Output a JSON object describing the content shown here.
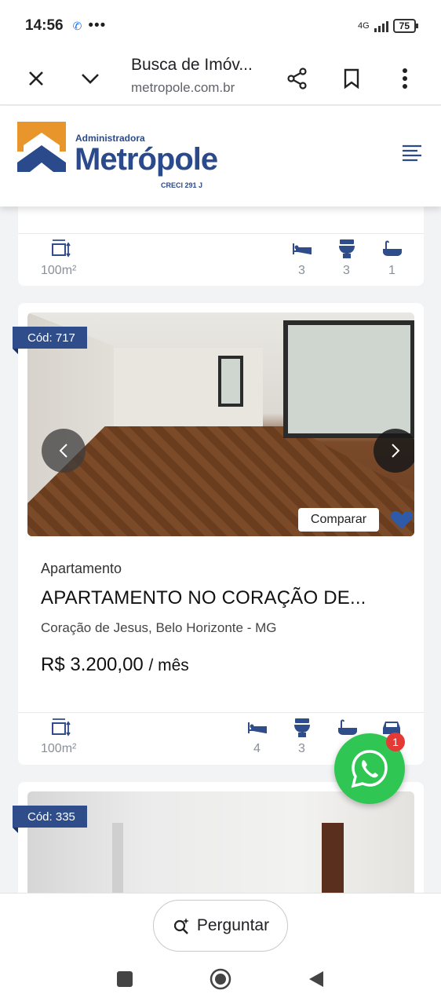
{
  "status": {
    "time": "14:56",
    "network": "4G",
    "battery": "75"
  },
  "browser": {
    "title": "Busca de Imóv...",
    "url": "metropole.com.br"
  },
  "site": {
    "brand_small": "Administradora",
    "brand": "Metrópole",
    "creci": "CRECI 291 J"
  },
  "card_top": {
    "area": "100m²",
    "bedrooms": "3",
    "bathrooms": "3",
    "suites": "1"
  },
  "listing": {
    "code": "Cód: 717",
    "compare_label": "Comparar",
    "type": "Apartamento",
    "title": "APARTAMENTO NO CORAÇÃO DE...",
    "location": "Coração de Jesus, Belo Horizonte - MG",
    "price": "R$ 3.200,00",
    "price_period": "/ mês",
    "area": "100m²",
    "bedrooms": "4",
    "bathrooms": "3"
  },
  "listing_next": {
    "code": "Cód: 335"
  },
  "whatsapp": {
    "badge": "1"
  },
  "bottom": {
    "ask_label": "Perguntar"
  },
  "colors": {
    "brand_blue": "#2b4a8c",
    "brand_orange": "#e8962c",
    "tag_blue": "#2f4d8a",
    "whatsapp_green": "#2fc654"
  }
}
